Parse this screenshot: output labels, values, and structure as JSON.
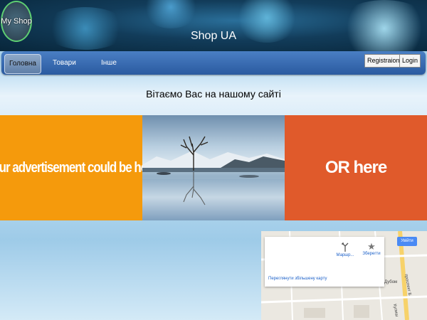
{
  "header": {
    "logo_text": "My Shop",
    "title": "Shop UA"
  },
  "nav": {
    "items": [
      "Головна",
      "Товари",
      "Інше"
    ],
    "register": "Registraion",
    "login": "Login"
  },
  "welcome": "Вітаємо Вас на нашому сайті",
  "banners": {
    "left": "Your advertisement could be here",
    "right": "OR here"
  },
  "map": {
    "route": "Маршр...",
    "save": "Зберегти",
    "view_larger": "Переглянути збільшену карту",
    "signin": "Увійти",
    "labels": [
      "Дубом",
      "проспект Б",
      "Кулиш"
    ]
  }
}
